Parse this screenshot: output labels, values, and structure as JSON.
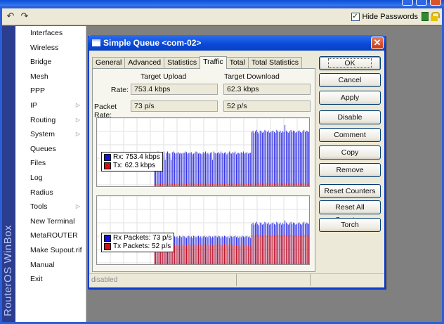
{
  "toolbar": {
    "undo_icon": "undo-icon",
    "redo_icon": "redo-icon",
    "hide_passwords": {
      "label": "Hide Passwords",
      "checked": true
    }
  },
  "brand": "RouterOS WinBox",
  "menu": [
    {
      "label": "Interfaces",
      "submenu": false
    },
    {
      "label": "Wireless",
      "submenu": false
    },
    {
      "label": "Bridge",
      "submenu": false
    },
    {
      "label": "Mesh",
      "submenu": false
    },
    {
      "label": "PPP",
      "submenu": false
    },
    {
      "label": "IP",
      "submenu": true
    },
    {
      "label": "Routing",
      "submenu": true
    },
    {
      "label": "System",
      "submenu": true
    },
    {
      "label": "Queues",
      "submenu": false
    },
    {
      "label": "Files",
      "submenu": false
    },
    {
      "label": "Log",
      "submenu": false
    },
    {
      "label": "Radius",
      "submenu": false
    },
    {
      "label": "Tools",
      "submenu": true
    },
    {
      "label": "New Terminal",
      "submenu": false
    },
    {
      "label": "MetaROUTER",
      "submenu": false
    },
    {
      "label": "Make Supout.rif",
      "submenu": false
    },
    {
      "label": "Manual",
      "submenu": false
    },
    {
      "label": "Exit",
      "submenu": false
    }
  ],
  "dialog": {
    "title": "Simple Queue <com-02>",
    "tabs": [
      "General",
      "Advanced",
      "Statistics",
      "Traffic",
      "Total",
      "Total Statistics"
    ],
    "active_tab": "Traffic",
    "traffic": {
      "upload_header": "Target Upload",
      "download_header": "Target Download",
      "rate_label": "Rate:",
      "rate_upload": "753.4 kbps",
      "rate_download": "62.3 kbps",
      "packet_rate_label": "Packet Rate:",
      "packet_rate_upload": "73 p/s",
      "packet_rate_download": "52 p/s"
    },
    "buttons": [
      "OK",
      "Cancel",
      "Apply",
      "Disable",
      "Comment",
      "Copy",
      "Remove",
      "Reset Counters",
      "Reset All Counters",
      "Torch"
    ],
    "status": [
      "disabled",
      "",
      ""
    ]
  },
  "chart_data": [
    {
      "type": "bar",
      "series": [
        {
          "name": "Rx",
          "legend": "Rx:  753.4 kbps",
          "color": "#1010e0",
          "values": [
            0,
            0,
            0,
            0,
            0,
            0,
            0,
            0,
            0,
            0,
            0,
            0,
            0,
            0,
            0,
            0,
            0,
            0,
            0,
            0,
            0,
            0,
            0,
            0,
            0,
            0,
            0,
            0,
            0,
            0,
            0,
            0,
            0,
            0,
            0,
            0,
            0,
            0,
            0,
            0,
            0,
            0,
            0,
            0,
            0,
            0,
            0,
            0,
            0.5,
            0.49,
            0.5,
            0.52,
            0.48,
            0.5,
            0.51,
            0.47,
            0.52,
            0.4,
            0.5,
            0.52,
            0.5,
            0.49,
            0.4,
            0.51,
            0.52,
            0.5,
            0.49,
            0.5,
            0.51,
            0.49,
            0.5,
            0.49,
            0.5,
            0.5,
            0.52,
            0.51,
            0.49,
            0.5,
            0.5,
            0.51,
            0.48,
            0.49,
            0.5,
            0.52,
            0.51,
            0.49,
            0.5,
            0.49,
            0.48,
            0.51,
            0.5,
            0.52,
            0.49,
            0.5,
            0.48,
            0.5,
            0.51,
            0.4,
            0.52,
            0.5,
            0.49,
            0.5,
            0.51,
            0.49,
            0.52,
            0.5,
            0.49,
            0.5,
            0.51,
            0.48,
            0.5,
            0.52,
            0.5,
            0.49,
            0.51,
            0.5,
            0.52,
            0.48,
            0.5,
            0.5,
            0.49,
            0.51,
            0.5,
            0.52,
            0.49,
            0.5,
            0.51,
            0.49,
            0.5,
            0.5,
            0.8,
            0.82,
            0.79,
            0.81,
            0.83,
            0.8,
            0.78,
            0.82,
            0.81,
            0.79,
            0.8,
            0.83,
            0.81,
            0.8,
            0.82,
            0.79,
            0.8,
            0.81,
            0.82,
            0.8,
            0.79,
            0.83,
            0.81,
            0.8,
            0.82,
            0.79,
            0.81,
            0.8,
            0.9,
            0.82,
            0.8,
            0.79,
            0.81,
            0.83,
            0.8,
            0.82,
            0.81,
            0.79,
            0.8,
            0.81,
            0.82,
            0.8,
            0.79,
            0.81,
            0.83,
            0.8,
            0.82,
            0.81,
            0.8,
            0.79
          ]
        },
        {
          "name": "Tx",
          "legend": "Tx:  62.3 kbps",
          "color": "#d01010",
          "values": [
            0,
            0,
            0,
            0,
            0,
            0,
            0,
            0,
            0,
            0,
            0,
            0,
            0,
            0,
            0,
            0,
            0,
            0,
            0,
            0,
            0,
            0,
            0,
            0,
            0,
            0,
            0,
            0,
            0,
            0,
            0,
            0,
            0,
            0,
            0,
            0,
            0,
            0,
            0,
            0,
            0,
            0,
            0,
            0,
            0,
            0,
            0,
            0,
            0.06,
            0.06,
            0.06,
            0.06,
            0.06,
            0.06,
            0.06,
            0.06,
            0.06,
            0.06,
            0.06,
            0.06,
            0.06,
            0.06,
            0.06,
            0.06,
            0.06,
            0.06,
            0.06,
            0.06,
            0.06,
            0.06,
            0.06,
            0.06,
            0.06,
            0.06,
            0.06,
            0.06,
            0.06,
            0.06,
            0.06,
            0.06,
            0.06,
            0.06,
            0.06,
            0.06,
            0.06,
            0.06,
            0.06,
            0.06,
            0.06,
            0.06,
            0.06,
            0.06,
            0.06,
            0.06,
            0.06,
            0.06,
            0.06,
            0.06,
            0.06,
            0.06,
            0.06,
            0.06,
            0.06,
            0.06,
            0.06,
            0.06,
            0.06,
            0.06,
            0.06,
            0.06,
            0.06,
            0.06,
            0.06,
            0.06,
            0.06,
            0.06,
            0.06,
            0.06,
            0.06,
            0.06,
            0.06,
            0.06,
            0.06,
            0.06,
            0.06,
            0.06,
            0.06,
            0.06,
            0.06,
            0.06,
            0.07,
            0.07,
            0.07,
            0.07,
            0.07,
            0.07,
            0.07,
            0.07,
            0.07,
            0.07,
            0.07,
            0.07,
            0.07,
            0.07,
            0.07,
            0.07,
            0.07,
            0.07,
            0.07,
            0.07,
            0.07,
            0.07,
            0.07,
            0.07,
            0.07,
            0.07,
            0.07,
            0.07,
            0.07,
            0.07,
            0.07,
            0.07,
            0.07,
            0.07,
            0.07,
            0.07,
            0.07,
            0.07,
            0.07,
            0.07,
            0.07,
            0.07,
            0.07,
            0.07,
            0.07,
            0.07,
            0.07,
            0.07,
            0.07,
            0.07
          ]
        }
      ],
      "ylim": [
        0,
        1
      ],
      "grid": true
    },
    {
      "type": "bar",
      "series": [
        {
          "name": "Rx Packets",
          "legend": "Rx Packets:  73 p/s",
          "color": "#1010e0",
          "values": [
            0,
            0,
            0,
            0,
            0,
            0,
            0,
            0,
            0,
            0,
            0,
            0,
            0,
            0,
            0,
            0,
            0,
            0,
            0,
            0,
            0,
            0,
            0,
            0,
            0,
            0,
            0,
            0,
            0,
            0,
            0,
            0,
            0,
            0,
            0,
            0,
            0,
            0,
            0,
            0,
            0,
            0,
            0,
            0,
            0,
            0,
            0,
            0,
            0.42,
            0.41,
            0.43,
            0.4,
            0.42,
            0.44,
            0.41,
            0.42,
            0.43,
            0.38,
            0.42,
            0.41,
            0.43,
            0.42,
            0.4,
            0.41,
            0.43,
            0.42,
            0.41,
            0.42,
            0.4,
            0.43,
            0.42,
            0.41,
            0.43,
            0.42,
            0.41,
            0.4,
            0.42,
            0.43,
            0.41,
            0.42,
            0.4,
            0.43,
            0.42,
            0.41,
            0.42,
            0.43,
            0.41,
            0.42,
            0.4,
            0.42,
            0.43,
            0.41,
            0.42,
            0.41,
            0.43,
            0.42,
            0.4,
            0.42,
            0.41,
            0.43,
            0.42,
            0.41,
            0.43,
            0.42,
            0.4,
            0.42,
            0.41,
            0.43,
            0.42,
            0.41,
            0.42,
            0.4,
            0.43,
            0.42,
            0.41,
            0.42,
            0.43,
            0.41,
            0.42,
            0.4,
            0.42,
            0.41,
            0.43,
            0.42,
            0.41,
            0.42,
            0.43,
            0.41,
            0.42,
            0.4,
            0.6,
            0.62,
            0.59,
            0.61,
            0.63,
            0.6,
            0.58,
            0.62,
            0.61,
            0.59,
            0.6,
            0.63,
            0.61,
            0.6,
            0.62,
            0.59,
            0.6,
            0.61,
            0.62,
            0.6,
            0.59,
            0.63,
            0.61,
            0.6,
            0.62,
            0.59,
            0.61,
            0.6,
            0.65,
            0.62,
            0.6,
            0.59,
            0.61,
            0.63,
            0.6,
            0.62,
            0.61,
            0.59,
            0.6,
            0.61,
            0.62,
            0.6,
            0.59,
            0.61,
            0.63,
            0.6,
            0.62,
            0.61,
            0.6,
            0.59
          ]
        },
        {
          "name": "Tx Packets",
          "legend": "Tx Packets:  52 p/s",
          "color": "#d01010",
          "values": [
            0,
            0,
            0,
            0,
            0,
            0,
            0,
            0,
            0,
            0,
            0,
            0,
            0,
            0,
            0,
            0,
            0,
            0,
            0,
            0,
            0,
            0,
            0,
            0,
            0,
            0,
            0,
            0,
            0,
            0,
            0,
            0,
            0,
            0,
            0,
            0,
            0,
            0,
            0,
            0,
            0,
            0,
            0,
            0,
            0,
            0,
            0,
            0,
            0.3,
            0.29,
            0.31,
            0.3,
            0.3,
            0.32,
            0.29,
            0.3,
            0.31,
            0.28,
            0.3,
            0.29,
            0.31,
            0.3,
            0.29,
            0.3,
            0.31,
            0.3,
            0.29,
            0.3,
            0.28,
            0.31,
            0.3,
            0.29,
            0.31,
            0.3,
            0.29,
            0.28,
            0.3,
            0.31,
            0.29,
            0.3,
            0.29,
            0.31,
            0.3,
            0.29,
            0.3,
            0.31,
            0.29,
            0.3,
            0.28,
            0.3,
            0.31,
            0.29,
            0.3,
            0.29,
            0.31,
            0.3,
            0.28,
            0.3,
            0.29,
            0.31,
            0.3,
            0.29,
            0.31,
            0.3,
            0.28,
            0.3,
            0.29,
            0.31,
            0.3,
            0.29,
            0.3,
            0.28,
            0.31,
            0.3,
            0.29,
            0.3,
            0.31,
            0.29,
            0.3,
            0.28,
            0.3,
            0.29,
            0.31,
            0.3,
            0.29,
            0.3,
            0.31,
            0.29,
            0.3,
            0.28,
            0.43,
            0.44,
            0.42,
            0.43,
            0.45,
            0.43,
            0.41,
            0.44,
            0.43,
            0.42,
            0.43,
            0.45,
            0.43,
            0.43,
            0.44,
            0.42,
            0.43,
            0.43,
            0.44,
            0.43,
            0.42,
            0.45,
            0.43,
            0.43,
            0.44,
            0.42,
            0.43,
            0.43,
            0.46,
            0.44,
            0.43,
            0.42,
            0.43,
            0.45,
            0.43,
            0.44,
            0.43,
            0.42,
            0.43,
            0.43,
            0.44,
            0.43,
            0.42,
            0.43,
            0.45,
            0.43,
            0.44,
            0.43,
            0.43,
            0.42
          ]
        }
      ],
      "ylim": [
        0,
        1
      ],
      "grid": true
    }
  ]
}
